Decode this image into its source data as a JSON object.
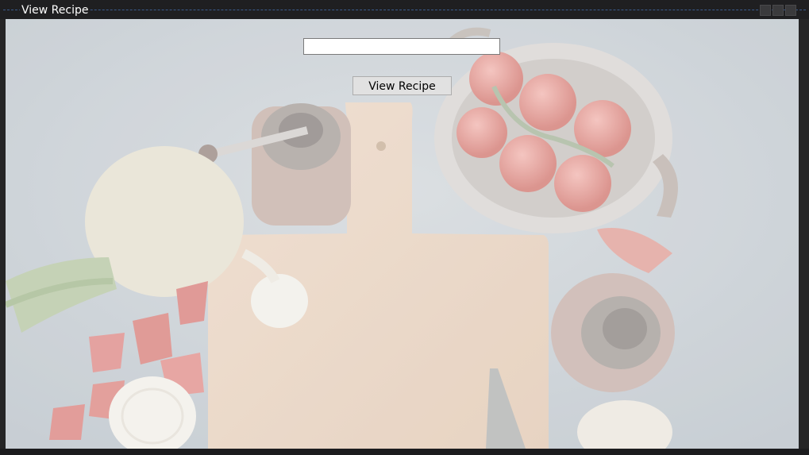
{
  "window": {
    "title": "View Recipe"
  },
  "search": {
    "value": "",
    "placeholder": ""
  },
  "main": {
    "view_recipe_label": "View Recipe"
  },
  "colors": {
    "titlebar": "#1f1f21",
    "button_face": "#e1e1e1",
    "title_text": "#ffffff"
  }
}
